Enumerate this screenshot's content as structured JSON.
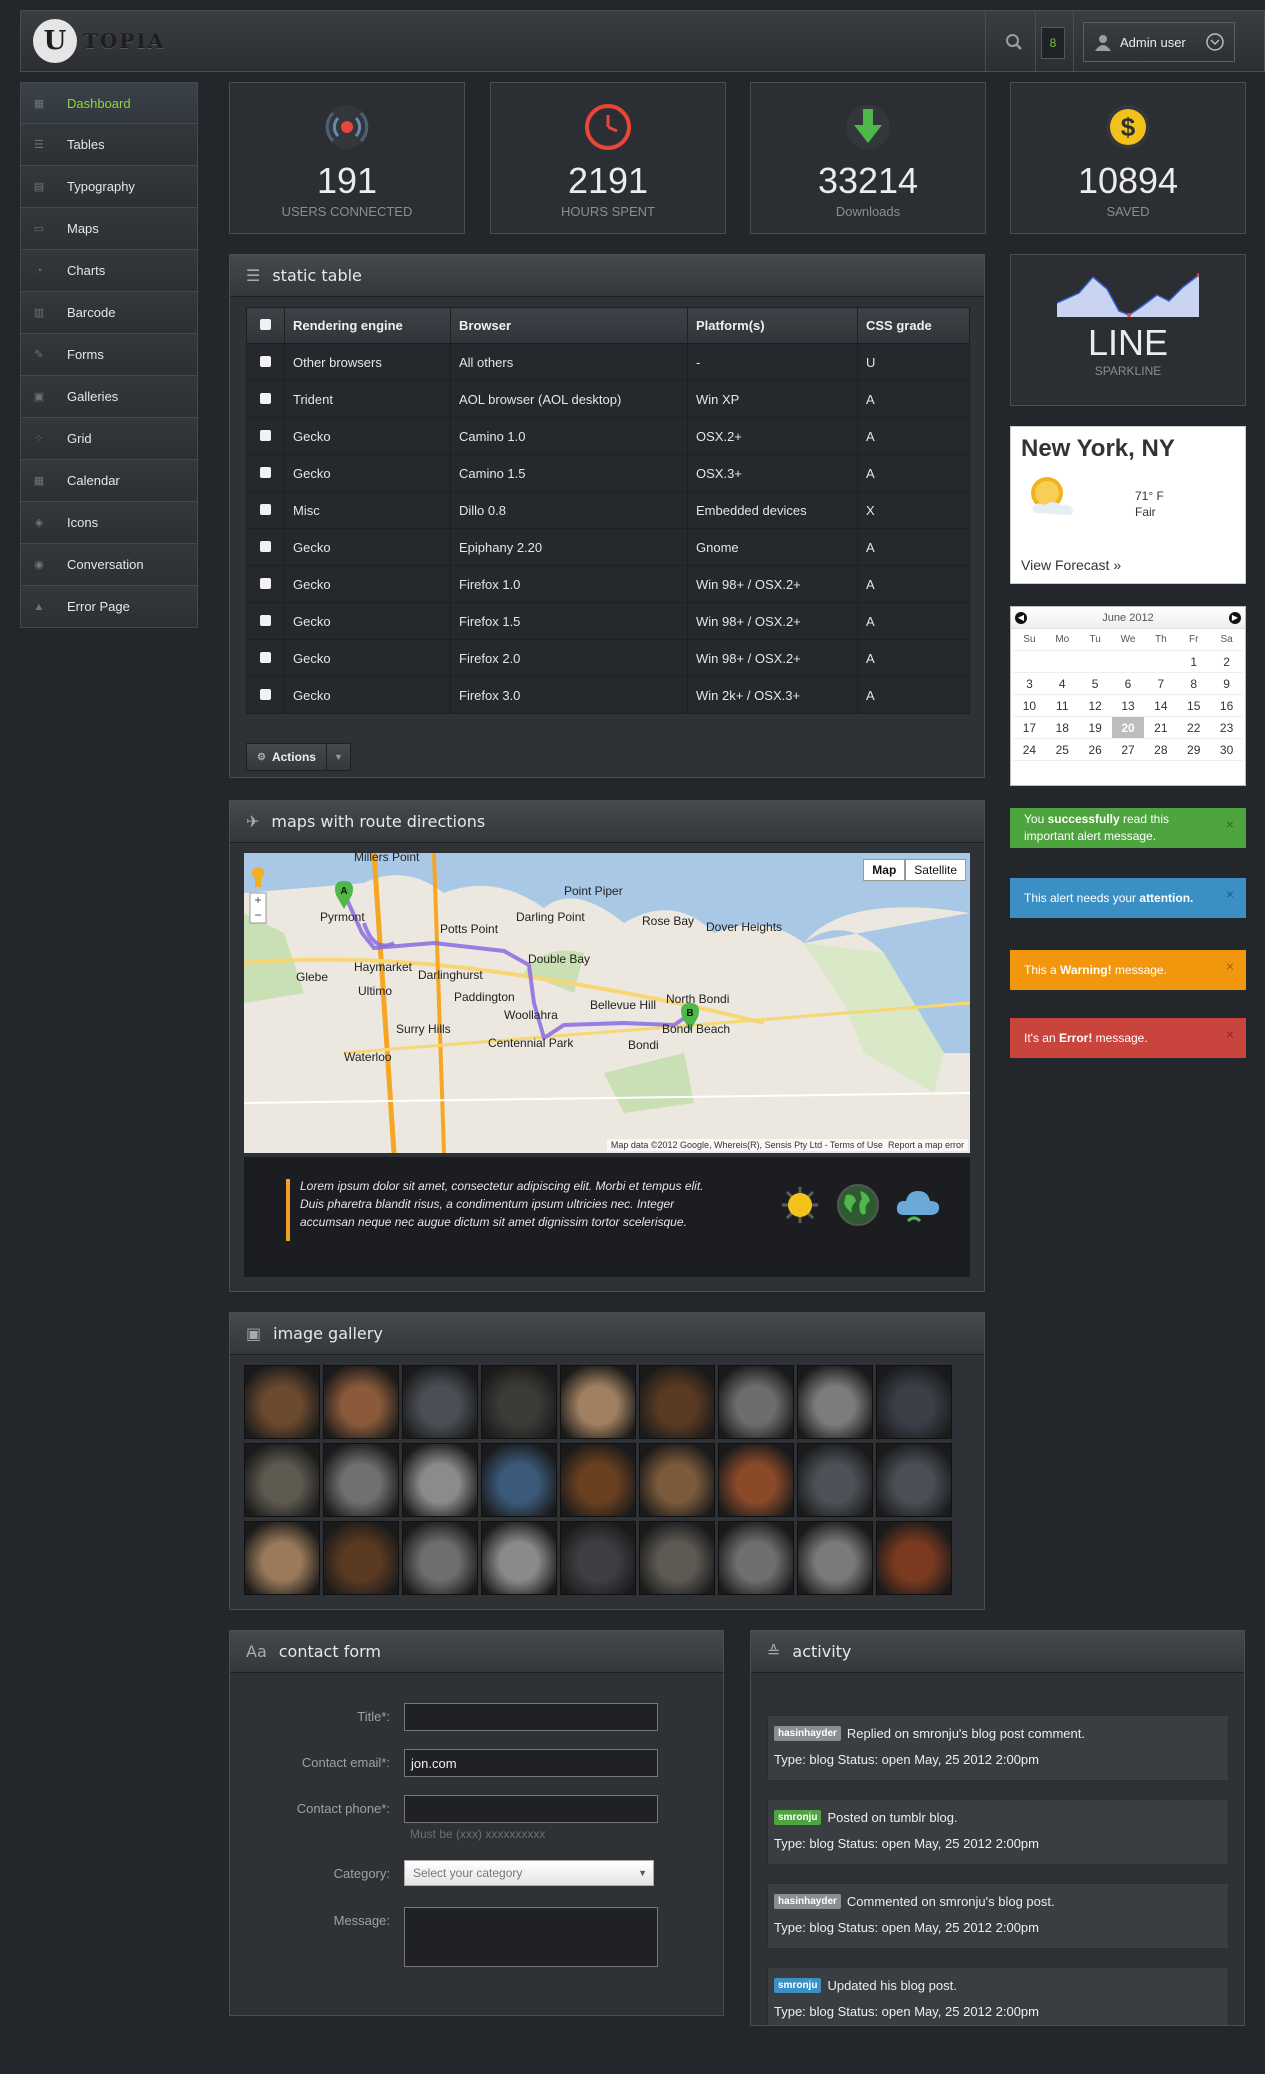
{
  "header": {
    "logo_letter": "U",
    "logo_text": "TOPIA",
    "notification_count": "8",
    "user_label": "Admin user"
  },
  "sidebar": {
    "items": [
      {
        "label": "Dashboard",
        "icon": "dashboard-icon",
        "active": true
      },
      {
        "label": "Tables",
        "icon": "list-icon"
      },
      {
        "label": "Typography",
        "icon": "typography-icon"
      },
      {
        "label": "Maps",
        "icon": "laptop-icon"
      },
      {
        "label": "Charts",
        "icon": "pie-chart-icon"
      },
      {
        "label": "Barcode",
        "icon": "barcode-icon"
      },
      {
        "label": "Forms",
        "icon": "pencil-icon"
      },
      {
        "label": "Galleries",
        "icon": "camera-icon"
      },
      {
        "label": "Grid",
        "icon": "grid-icon"
      },
      {
        "label": "Calendar",
        "icon": "calendar-icon"
      },
      {
        "label": "Icons",
        "icon": "tags-icon"
      },
      {
        "label": "Conversation",
        "icon": "chat-icon"
      },
      {
        "label": "Error Page",
        "icon": "warning-icon"
      }
    ]
  },
  "stats": [
    {
      "value": "191",
      "label": "USERS CONNECTED",
      "icon": "broadcast-icon",
      "color": "#e8453c"
    },
    {
      "value": "2191",
      "label": "HOURS SPENT",
      "icon": "clock-icon",
      "color": "#e8453c"
    },
    {
      "value": "33214",
      "label": "Downloads",
      "icon": "download-arrow-icon",
      "color": "#4fb84a"
    },
    {
      "value": "10894",
      "label": "SAVED",
      "icon": "dollar-coin-icon",
      "color": "#f2c21b"
    }
  ],
  "static_table": {
    "title": "static table",
    "columns": [
      "Rendering engine",
      "Browser",
      "Platform(s)",
      "CSS grade"
    ],
    "rows": [
      [
        "Other browsers",
        "All others",
        "-",
        "U"
      ],
      [
        "Trident",
        "AOL browser (AOL desktop)",
        "Win XP",
        "A"
      ],
      [
        "Gecko",
        "Camino 1.0",
        "OSX.2+",
        "A"
      ],
      [
        "Gecko",
        "Camino 1.5",
        "OSX.3+",
        "A"
      ],
      [
        "Misc",
        "Dillo 0.8",
        "Embedded devices",
        "X"
      ],
      [
        "Gecko",
        "Epiphany 2.20",
        "Gnome",
        "A"
      ],
      [
        "Gecko",
        "Firefox 1.0",
        "Win 98+ / OSX.2+",
        "A"
      ],
      [
        "Gecko",
        "Firefox 1.5",
        "Win 98+ / OSX.2+",
        "A"
      ],
      [
        "Gecko",
        "Firefox 2.0",
        "Win 98+ / OSX.2+",
        "A"
      ],
      [
        "Gecko",
        "Firefox 3.0",
        "Win 2k+ / OSX.3+",
        "A"
      ]
    ],
    "actions_label": "Actions"
  },
  "map_panel": {
    "title": "maps with route directions",
    "map_button": "Map",
    "satellite_button": "Satellite",
    "attribution": "Map data ©2012 Google, Whereis(R), Sensis Pty Ltd - Terms of Use",
    "report_link": "Report a map error",
    "places": [
      "Millers Point",
      "Pyrmont",
      "Potts Point",
      "Darling Point",
      "Point Piper",
      "Rose Bay",
      "Dover Heights",
      "Glebe",
      "Haymarket",
      "Ultimo",
      "Darlinghurst",
      "Double Bay",
      "Paddington",
      "Woollahra",
      "Bellevue Hill",
      "North Bondi",
      "Bondi Beach",
      "Surry Hills",
      "Waterloo",
      "Centennial Park",
      "Bondi"
    ],
    "marker_a": "A",
    "marker_b": "B",
    "quote": "Lorem ipsum dolor sit amet, consectetur adipiscing elit. Morbi et tempus elit. Duis pharetra blandit risus, a condimentum ipsum ultricies nec. Integer accumsan neque nec augue dictum sit amet dignissim tortor scelerisque."
  },
  "gallery": {
    "title": "image gallery",
    "thumb_colors": [
      "#6b4a2f",
      "#8a5a3a",
      "#4b4f55",
      "#3d3b38",
      "#a08060",
      "#5a3a22",
      "#6d6d6d",
      "#7c7c7c",
      "#3a3f48",
      "#5e5a50",
      "#707070",
      "#8b8b8b",
      "#3b5a7a",
      "#6a4020",
      "#7a5a3a",
      "#8a4a2a",
      "#4d5258",
      "#4a4f56",
      "#9a7a5a",
      "#5b3a22",
      "#6e6e6e",
      "#8a8a8a",
      "#3e3f42",
      "#5d5a54",
      "#6f6f6f",
      "#7a7a7a",
      "#7b3a20"
    ]
  },
  "contact_form": {
    "title": "contact form",
    "title_label": "Title*:",
    "email_label": "Contact email*:",
    "email_value": "jon.com",
    "phone_label": "Contact phone*:",
    "phone_help": "Must be (xxx) xxxxxxxxxx",
    "category_label": "Category:",
    "category_placeholder": "Select your category",
    "message_label": "Message:"
  },
  "activity": {
    "title": "activity",
    "items": [
      {
        "user": "hasinhayder",
        "tag_color": "gray",
        "text": "Replied on smronju's blog post comment.",
        "meta": "Type: blog Status: open May, 25 2012 2:00pm"
      },
      {
        "user": "smronju",
        "tag_color": "green",
        "text": "Posted on tumblr blog.",
        "meta": "Type: blog Status: open May, 25 2012 2:00pm"
      },
      {
        "user": "hasinhayder",
        "tag_color": "gray",
        "text": "Commented on smronju's blog post.",
        "meta": "Type: blog Status: open May, 25 2012 2:00pm"
      },
      {
        "user": "smronju",
        "tag_color": "blue",
        "text": "Updated his blog post.",
        "meta": "Type: blog Status: open May, 25 2012 2:00pm"
      }
    ]
  },
  "sparkline": {
    "title": "LINE",
    "subtitle": "SPARKLINE"
  },
  "weather": {
    "city": "New York, NY",
    "temp": "71° F",
    "condition": "Fair",
    "link": "View Forecast »"
  },
  "calendar": {
    "month": "June 2012",
    "days_of_week": [
      "Su",
      "Mo",
      "Tu",
      "We",
      "Th",
      "Fr",
      "Sa"
    ],
    "weeks": [
      [
        "",
        "",
        "",
        "",
        "",
        "1",
        "2"
      ],
      [
        "3",
        "4",
        "5",
        "6",
        "7",
        "8",
        "9"
      ],
      [
        "10",
        "11",
        "12",
        "13",
        "14",
        "15",
        "16"
      ],
      [
        "17",
        "18",
        "19",
        "20",
        "21",
        "22",
        "23"
      ],
      [
        "24",
        "25",
        "26",
        "27",
        "28",
        "29",
        "30"
      ]
    ],
    "today": "20"
  },
  "alerts": [
    {
      "type": "success",
      "color": "#4ea43e",
      "pre": "You ",
      "bold": "successfully",
      "post": " read this important alert message."
    },
    {
      "type": "info",
      "color": "#3a8fc4",
      "pre": "This alert needs your ",
      "bold": "attention.",
      "post": ""
    },
    {
      "type": "warning",
      "color": "#f2960d",
      "pre": "This a ",
      "bold": "Warning!",
      "post": " message."
    },
    {
      "type": "error",
      "color": "#c9443c",
      "pre": "It's an ",
      "bold": "Error!",
      "post": " message."
    }
  ]
}
